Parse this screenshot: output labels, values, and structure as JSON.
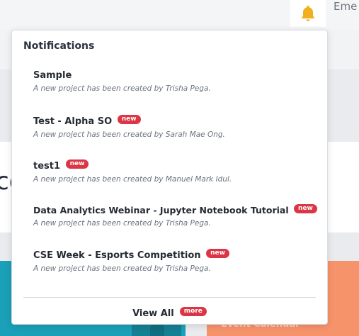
{
  "topbar": {
    "bell_icon": "bell-icon",
    "bell_color": "#f2b01e",
    "user_name_partial": "Eme"
  },
  "background": {
    "partial_heading": "co",
    "orange_card_label": "Event Calendar"
  },
  "notifications": {
    "title": "Notifications",
    "badge_label": "new",
    "items": [
      {
        "title": "Sample",
        "message": "A new project has been created by Trisha Pega.",
        "badge": ""
      },
      {
        "title": "Test - Alpha SO",
        "message": "A new project has been created by Sarah Mae Ong.",
        "badge": "new"
      },
      {
        "title": "test1",
        "message": "A new project has been created by Manuel Mark Idul.",
        "badge": "new"
      },
      {
        "title": "Data Analytics Webinar - Jupyter Notebook Tutorial",
        "message": "A new project has been created by Trisha Pega.",
        "badge": "new"
      },
      {
        "title": "CSE Week - Esports Competition",
        "message": "A new project has been created by Trisha Pega.",
        "badge": "new"
      }
    ],
    "view_all_label": "View All",
    "more_badge": "more"
  },
  "colors": {
    "badge": "#dc3545",
    "teal_card": "#1aa0b8",
    "orange_card": "#f7936b"
  }
}
